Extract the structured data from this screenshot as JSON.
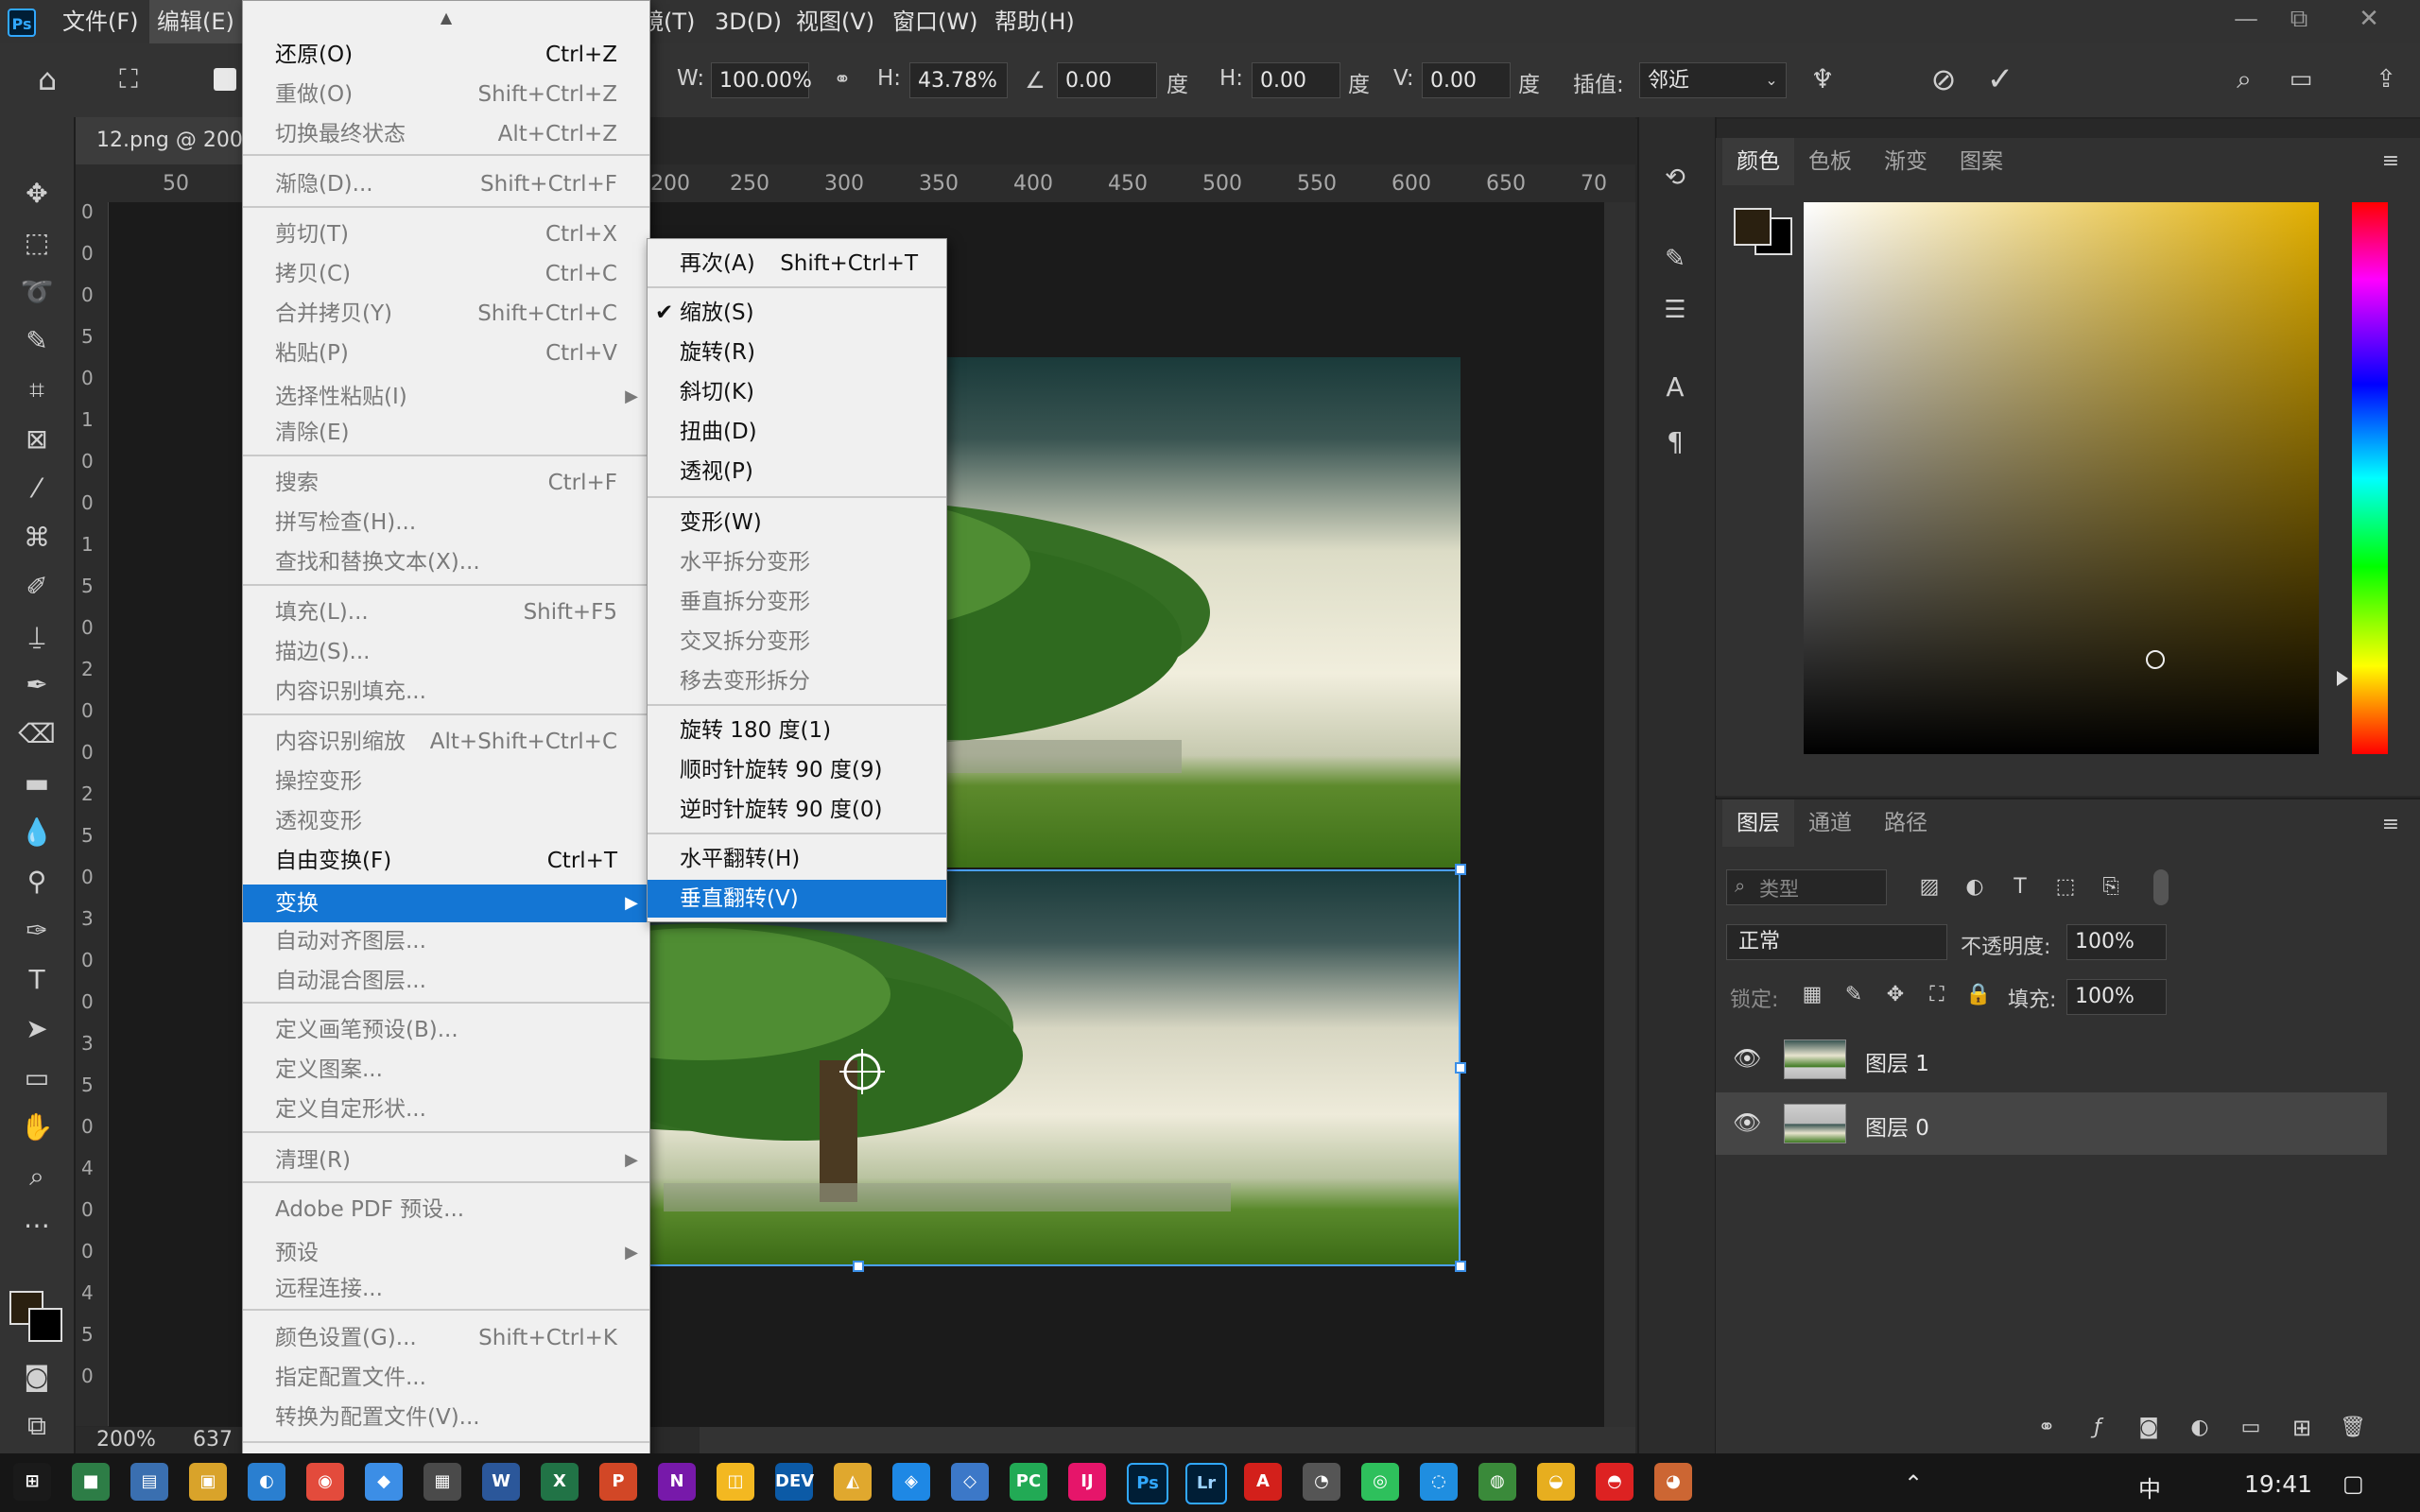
{
  "app": {
    "logo": "Ps"
  },
  "menubar": {
    "items": [
      {
        "label": "文件(F)"
      },
      {
        "label": "编辑(E)"
      },
      {
        "label": "镜(T)"
      },
      {
        "label": "3D(D)"
      },
      {
        "label": "视图(V)"
      },
      {
        "label": "窗口(W)"
      },
      {
        "label": "帮助(H)"
      }
    ],
    "window_buttons": [
      "—",
      "⧉",
      "✕"
    ]
  },
  "options": {
    "w_label": "W:",
    "w_value": "100.00%",
    "h_label": "H:",
    "h_value": "43.78%",
    "angle_value": "0.00",
    "angle_unit": "度",
    "hskew_label": "H:",
    "hskew_value": "0.00",
    "hskew_unit": "度",
    "vskew_label": "V:",
    "vskew_value": "0.00",
    "vskew_unit": "度",
    "interp_label": "插值:",
    "interp_value": "邻近"
  },
  "document": {
    "tab_title": "12.png @ 200",
    "ruler_h": [
      "50",
      "200",
      "250",
      "300",
      "350",
      "400",
      "450",
      "500",
      "550",
      "600",
      "650",
      "70"
    ],
    "ruler_v": [
      "0",
      "0",
      "0",
      "5",
      "0",
      "1",
      "0",
      "0",
      "1",
      "5",
      "0",
      "2",
      "0",
      "0",
      "2",
      "5",
      "0",
      "3",
      "0",
      "0",
      "3",
      "5",
      "0",
      "4",
      "0",
      "0",
      "4",
      "5",
      "0"
    ],
    "zoom": "200%",
    "size": "637"
  },
  "edit_menu": {
    "items": [
      {
        "label": "还原(O)",
        "shortcut": "Ctrl+Z",
        "enabled": true
      },
      {
        "label": "重做(O)",
        "shortcut": "Shift+Ctrl+Z",
        "enabled": false
      },
      {
        "label": "切换最终状态",
        "shortcut": "Alt+Ctrl+Z",
        "enabled": false
      },
      {
        "label": "渐隐(D)...",
        "shortcut": "Shift+Ctrl+F",
        "enabled": false
      },
      {
        "label": "剪切(T)",
        "shortcut": "Ctrl+X",
        "enabled": false
      },
      {
        "label": "拷贝(C)",
        "shortcut": "Ctrl+C",
        "enabled": false
      },
      {
        "label": "合并拷贝(Y)",
        "shortcut": "Shift+Ctrl+C",
        "enabled": false
      },
      {
        "label": "粘贴(P)",
        "shortcut": "Ctrl+V",
        "enabled": false
      },
      {
        "label": "选择性粘贴(I)",
        "shortcut": "",
        "enabled": false,
        "submenu": true
      },
      {
        "label": "清除(E)",
        "shortcut": "",
        "enabled": false
      },
      {
        "label": "搜索",
        "shortcut": "Ctrl+F",
        "enabled": false
      },
      {
        "label": "拼写检查(H)...",
        "shortcut": "",
        "enabled": false
      },
      {
        "label": "查找和替换文本(X)...",
        "shortcut": "",
        "enabled": false
      },
      {
        "label": "填充(L)...",
        "shortcut": "Shift+F5",
        "enabled": false
      },
      {
        "label": "描边(S)...",
        "shortcut": "",
        "enabled": false
      },
      {
        "label": "内容识别填充...",
        "shortcut": "",
        "enabled": false
      },
      {
        "label": "内容识别缩放",
        "shortcut": "Alt+Shift+Ctrl+C",
        "enabled": false
      },
      {
        "label": "操控变形",
        "shortcut": "",
        "enabled": false
      },
      {
        "label": "透视变形",
        "shortcut": "",
        "enabled": false
      },
      {
        "label": "自由变换(F)",
        "shortcut": "Ctrl+T",
        "enabled": true
      },
      {
        "label": "变换",
        "shortcut": "",
        "enabled": true,
        "submenu": true,
        "highlighted": true
      },
      {
        "label": "自动对齐图层...",
        "shortcut": "",
        "enabled": false
      },
      {
        "label": "自动混合图层...",
        "shortcut": "",
        "enabled": false
      },
      {
        "label": "定义画笔预设(B)...",
        "shortcut": "",
        "enabled": false
      },
      {
        "label": "定义图案...",
        "shortcut": "",
        "enabled": false
      },
      {
        "label": "定义自定形状...",
        "shortcut": "",
        "enabled": false
      },
      {
        "label": "清理(R)",
        "shortcut": "",
        "enabled": false,
        "submenu": true
      },
      {
        "label": "Adobe PDF 预设...",
        "shortcut": "",
        "enabled": false
      },
      {
        "label": "预设",
        "shortcut": "",
        "enabled": false,
        "submenu": true
      },
      {
        "label": "远程连接...",
        "shortcut": "",
        "enabled": false
      },
      {
        "label": "颜色设置(G)...",
        "shortcut": "Shift+Ctrl+K",
        "enabled": false
      },
      {
        "label": "指定配置文件...",
        "shortcut": "",
        "enabled": false
      },
      {
        "label": "转换为配置文件(V)...",
        "shortcut": "",
        "enabled": false
      }
    ]
  },
  "transform_menu": {
    "items": [
      {
        "label": "再次(A)",
        "shortcut": "Shift+Ctrl+T",
        "enabled": true
      },
      {
        "label": "缩放(S)",
        "enabled": true,
        "checked": true
      },
      {
        "label": "旋转(R)",
        "enabled": true
      },
      {
        "label": "斜切(K)",
        "enabled": true
      },
      {
        "label": "扭曲(D)",
        "enabled": true
      },
      {
        "label": "透视(P)",
        "enabled": true
      },
      {
        "label": "变形(W)",
        "enabled": true
      },
      {
        "label": "水平拆分变形",
        "enabled": false
      },
      {
        "label": "垂直拆分变形",
        "enabled": false
      },
      {
        "label": "交叉拆分变形",
        "enabled": false
      },
      {
        "label": "移去变形拆分",
        "enabled": false
      },
      {
        "label": "旋转 180 度(1)",
        "enabled": true
      },
      {
        "label": "顺时针旋转 90 度(9)",
        "enabled": true
      },
      {
        "label": "逆时针旋转 90 度(0)",
        "enabled": true
      },
      {
        "label": "水平翻转(H)",
        "enabled": true
      },
      {
        "label": "垂直翻转(V)",
        "enabled": true,
        "highlighted": true
      }
    ]
  },
  "color_panel": {
    "tabs": [
      "颜色",
      "色板",
      "渐变",
      "图案"
    ],
    "foreground": "#2a2010",
    "background": "#000000",
    "picker_hue": "#e2af00"
  },
  "layers_panel": {
    "tabs": [
      "图层",
      "通道",
      "路径"
    ],
    "filter_placeholder": "类型",
    "blend_mode": "正常",
    "opacity_label": "不透明度:",
    "opacity_value": "100%",
    "lock_label": "锁定:",
    "fill_label": "填充:",
    "fill_value": "100%",
    "layers": [
      {
        "name": "图层 1",
        "visible": true,
        "selected": false
      },
      {
        "name": "图层 0",
        "visible": true,
        "selected": true
      }
    ]
  },
  "taskbar": {
    "apps": [
      "⊞",
      "■",
      "▤",
      "▣",
      "◐",
      "◉",
      "◆",
      "▦",
      "W",
      "X",
      "P",
      "N",
      "◫",
      "DEV",
      "◭",
      "◈",
      "◇",
      "PC",
      "IJ",
      "Ps",
      "Lr",
      "A",
      "◔",
      "◎",
      "◌",
      "◍",
      "◒",
      "◓",
      "◕"
    ],
    "ime": "中",
    "clock": "19:41"
  }
}
